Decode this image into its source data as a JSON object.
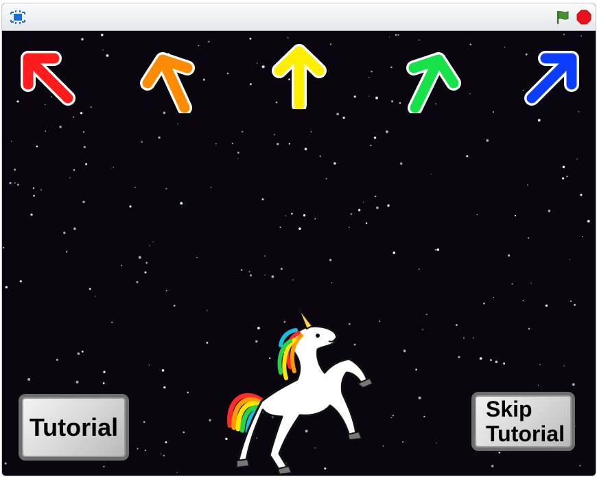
{
  "toolbar": {
    "fullscreen_icon": "fullscreen-icon",
    "flag_icon": "green-flag-icon",
    "stop_icon": "stop-icon",
    "flag_color": "#4a8f2e",
    "stop_color": "#e8121a"
  },
  "stage": {
    "background_color": "#0a0610",
    "arrows": [
      {
        "name": "left",
        "direction": "up-left",
        "color": "#ff1c1c"
      },
      {
        "name": "down",
        "direction": "up-left",
        "color": "#ff8c00"
      },
      {
        "name": "up",
        "direction": "up",
        "color": "#ffee00"
      },
      {
        "name": "right",
        "direction": "up-right",
        "color": "#16e34a"
      },
      {
        "name": "extra",
        "direction": "up-right",
        "color": "#0a3dff"
      }
    ],
    "tutorial_button": {
      "label": "Tutorial"
    },
    "skip_button": {
      "label_line1": "Skip",
      "label_line2": "Tutorial"
    },
    "sprite": "unicorn"
  }
}
